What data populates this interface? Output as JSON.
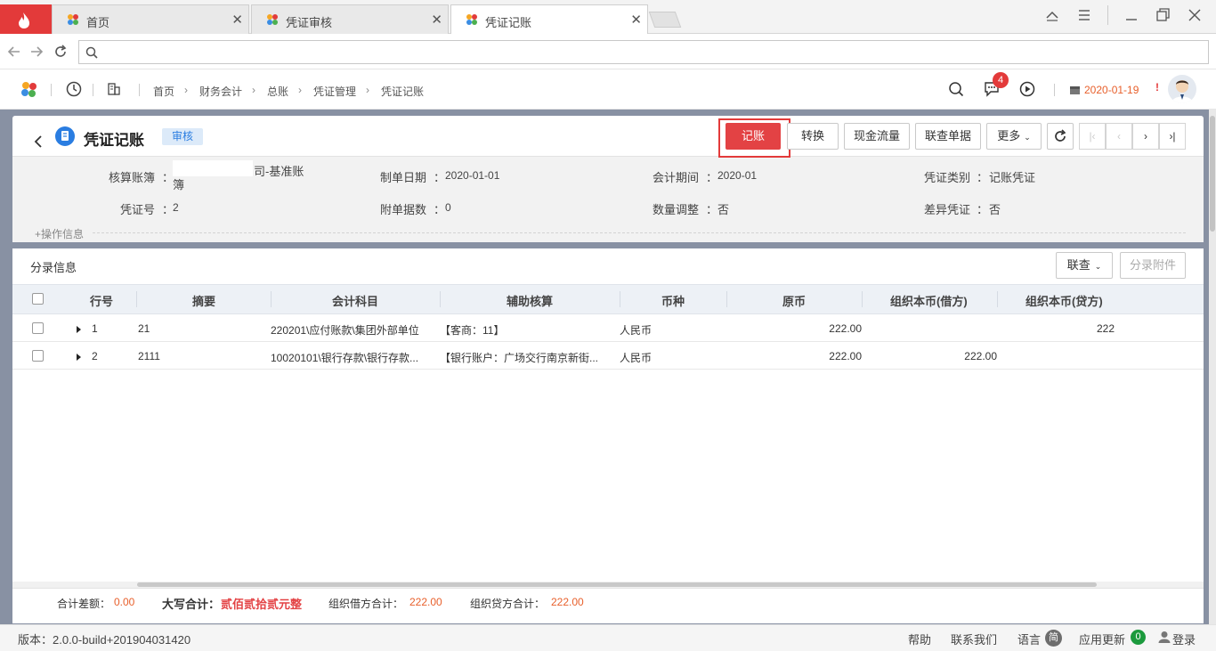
{
  "tabs": [
    {
      "label": "首页",
      "active": false
    },
    {
      "label": "凭证审核",
      "active": false
    },
    {
      "label": "凭证记账",
      "active": true
    }
  ],
  "breadcrumb": [
    "首页",
    "财务会计",
    "总账",
    "凭证管理",
    "凭证记账"
  ],
  "header": {
    "notification_count": "4",
    "date": "2020-01-19",
    "date_alert": "!"
  },
  "page": {
    "title": "凭证记账",
    "status": "审核"
  },
  "toolbar": {
    "post": "记账",
    "convert": "转换",
    "cashflow": "现金流量",
    "linked_docs": "联查单据",
    "more": "更多"
  },
  "info": {
    "ledger_label": "核算账簿",
    "ledger_value_a": "司-基准账",
    "ledger_value_b": "簿",
    "date_label": "制单日期",
    "date_value": "2020-01-01",
    "period_label": "会计期间",
    "period_value": "2020-01",
    "type_label": "凭证类别",
    "type_value": "记账凭证",
    "no_label": "凭证号",
    "no_value": "2",
    "attach_label": "附单据数",
    "attach_value": "0",
    "qty_label": "数量调整",
    "qty_value": "否",
    "diff_label": "差异凭证",
    "diff_value": "否",
    "ops_link": "+操作信息",
    "colon": "："
  },
  "entries": {
    "title": "分录信息",
    "linked_btn": "联查",
    "attach_btn": "分录附件",
    "columns": [
      "行号",
      "摘要",
      "会计科目",
      "辅助核算",
      "币种",
      "原币",
      "组织本币(借方)",
      "组织本币(贷方)"
    ],
    "rows": [
      {
        "no": "1",
        "summary": "21",
        "account": "220201\\应付账款\\集团外部单位",
        "aux": "【客商：11】",
        "currency": "人民币",
        "amount": "222.00",
        "debit": "",
        "credit": "222"
      },
      {
        "no": "2",
        "summary": "2111",
        "account": "10020101\\银行存款\\银行存款...",
        "aux": "【银行账户：广场交行南京新街...",
        "currency": "人民币",
        "amount": "222.00",
        "debit": "222.00",
        "credit": ""
      }
    ]
  },
  "footer": {
    "diff_label": "合计差额：",
    "diff_value": "0.00",
    "upper_label": "大写合计：",
    "upper_value": "贰佰贰拾贰元整",
    "debit_label": "组织借方合计：",
    "debit_value": "222.00",
    "credit_label": "组织贷方合计：",
    "credit_value": "222.00"
  },
  "status": {
    "version": "版本：2.0.0-build+201904031420",
    "help": "帮助",
    "contact": "联系我们",
    "language": "语言",
    "lang_badge": "简",
    "update": "应用更新",
    "update_count": "0",
    "login": "登录"
  },
  "colors": {
    "accent": "#e34244",
    "primary_blue": "#2a7de1",
    "orange": "#e8602c",
    "header_bg": "#edf1f6"
  }
}
